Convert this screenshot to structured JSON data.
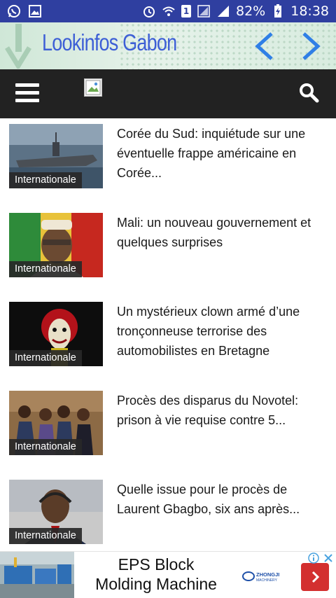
{
  "status_bar": {
    "battery": "82%",
    "time": "18:38",
    "sim": "1",
    "icons": [
      "whatsapp-icon",
      "image-icon",
      "alarm-icon",
      "wifi-icon",
      "sim-icon",
      "signal-icon",
      "battery-charging-icon"
    ]
  },
  "banner": {
    "title": "Lookinfos Gabon"
  },
  "colors": {
    "status_bar": "#2f3fa0",
    "toolbar": "#222222",
    "banner_title": "#3d5fd6",
    "nav_arrow": "#2f7fe6",
    "badge_bg": "#282828",
    "ad_cta": "#d32f2f"
  },
  "articles": [
    {
      "category": "Internationale",
      "headline": "Corée du Sud: inquiétude sur une éventuelle frappe américaine en Corée..."
    },
    {
      "category": "Internationale",
      "headline": "Mali: un nouveau gouvernement et quelques surprises"
    },
    {
      "category": "Internationale",
      "headline": "Un mystérieux clown armé d’une tronçonneuse terrorise des automobilistes en Bretagne"
    },
    {
      "category": "Internationale",
      "headline": "Procès des disparus du Novotel: prison à vie requise contre 5..."
    },
    {
      "category": "Internationale",
      "headline": "Quelle issue pour le procès de Laurent Gbagbo, six ans après..."
    }
  ],
  "ad": {
    "line1": "EPS Block",
    "line2": "Molding Machine",
    "brand": "ZHONGJI",
    "brand_sub": "MACHINERY"
  }
}
